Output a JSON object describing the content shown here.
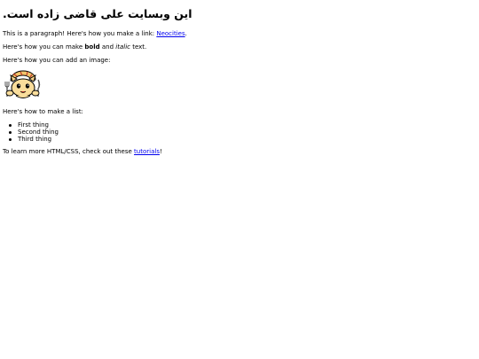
{
  "heading": "این وبسایت علی قاضی زاده است.",
  "intro": {
    "before_link": "This is a paragraph! Here's how you make a link: ",
    "link_label": "Neocities",
    "after_link": "."
  },
  "formatting": {
    "before_bold": "Here's how you can make ",
    "bold": "bold",
    "between": " and ",
    "italic": "italic",
    "after": " text."
  },
  "image_intro": "Here's how you can add an image:",
  "image": {
    "icon": "neocities-cat-mascot-icon"
  },
  "list_intro": "Here's how to make a list:",
  "list_items": [
    "First thing",
    "Second thing",
    "Third thing"
  ],
  "outro": {
    "before_link": "To learn more HTML/CSS, check out these ",
    "link_label": "tutorials",
    "after_link": "!"
  },
  "colors": {
    "link": "#0000ee",
    "text": "#000000",
    "background": "#ffffff"
  }
}
